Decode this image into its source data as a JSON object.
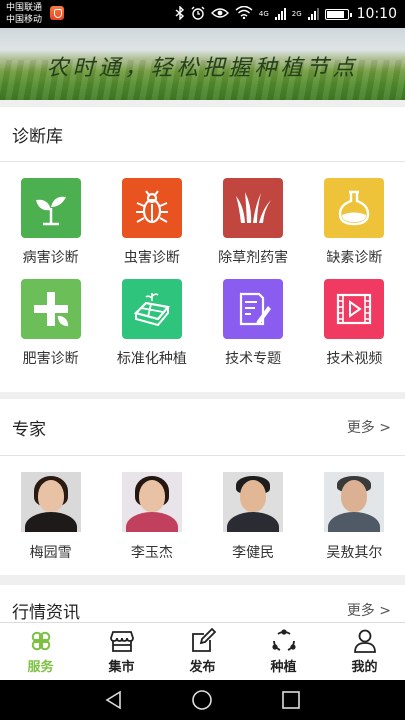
{
  "status_bar": {
    "carrier_1": "中国联通",
    "carrier_2": "中国移动",
    "net_4g": "4G",
    "net_2g": "2G",
    "time": "10:10",
    "icons": [
      "bluetooth-icon",
      "alarm-icon",
      "eye-icon",
      "wifi-icon",
      "signal-icon",
      "battery-icon"
    ]
  },
  "banner": {
    "text": "农时通，轻松把握种植节点"
  },
  "diagnosis": {
    "title": "诊断库",
    "items": [
      {
        "label": "病害诊断",
        "icon": "seedling-icon",
        "color": "#4caf50"
      },
      {
        "label": "虫害诊断",
        "icon": "bug-icon",
        "color": "#e8531f"
      },
      {
        "label": "除草剂药害",
        "icon": "grass-icon",
        "color": "#c0463f"
      },
      {
        "label": "缺素诊断",
        "icon": "flask-icon",
        "color": "#eec33a"
      },
      {
        "label": "肥害诊断",
        "icon": "plus-leaf-icon",
        "color": "#6cbf58"
      },
      {
        "label": "标准化种植",
        "icon": "field-plot-icon",
        "color": "#2fc47c"
      },
      {
        "label": "技术专题",
        "icon": "document-pen-icon",
        "color": "#8b5cf0"
      },
      {
        "label": "技术视频",
        "icon": "video-icon",
        "color": "#f03a62"
      }
    ]
  },
  "experts": {
    "title": "专家",
    "more": "更多 >",
    "items": [
      {
        "name": "梅园雪"
      },
      {
        "name": "李玉杰"
      },
      {
        "name": "李健民"
      },
      {
        "name": "吴敖其尔"
      }
    ]
  },
  "market_news": {
    "title": "行情资讯",
    "more": "更多 >"
  },
  "tabbar": {
    "tabs": [
      {
        "label": "服务",
        "icon": "grid-flower-icon",
        "active": true
      },
      {
        "label": "集市",
        "icon": "store-icon",
        "active": false
      },
      {
        "label": "发布",
        "icon": "edit-icon",
        "active": false
      },
      {
        "label": "种植",
        "icon": "cycle-icon",
        "active": false
      },
      {
        "label": "我的",
        "icon": "user-icon",
        "active": false
      }
    ],
    "active_color": "#7cc142"
  },
  "nav": {
    "icons": [
      "back-icon",
      "home-icon",
      "recents-icon"
    ]
  }
}
